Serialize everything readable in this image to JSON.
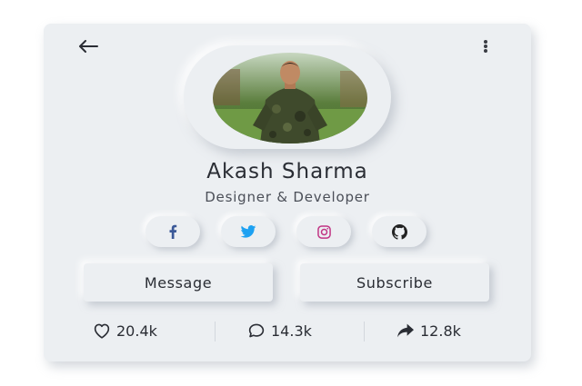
{
  "profile": {
    "name": "Akash Sharma",
    "role": "Designer & Developer"
  },
  "social": [
    {
      "icon": "facebook-icon",
      "color": "#3b5998"
    },
    {
      "icon": "twitter-icon",
      "color": "#1da1f2"
    },
    {
      "icon": "instagram-icon",
      "color": "#c13584"
    },
    {
      "icon": "github-icon",
      "color": "#222222"
    }
  ],
  "actions": {
    "message_label": "Message",
    "subscribe_label": "Subscribe"
  },
  "stats": {
    "likes": "20.4k",
    "comments": "14.3k",
    "shares": "12.8k"
  },
  "colors": {
    "card_bg": "#eceff2",
    "text": "#2a2d34"
  }
}
